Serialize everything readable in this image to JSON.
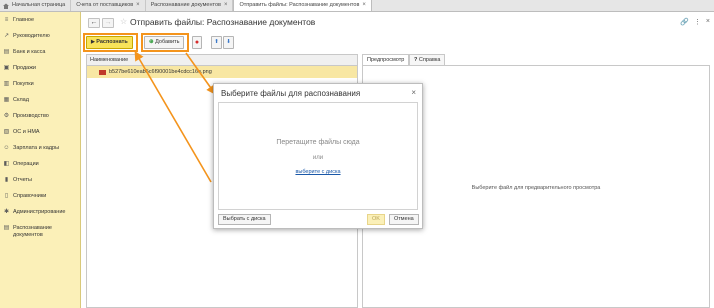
{
  "tabs": [
    {
      "label": "Начальная страница",
      "closable": false
    },
    {
      "label": "Счета от поставщиков",
      "closable": true
    },
    {
      "label": "Распознавание документов",
      "closable": true
    },
    {
      "label": "Отправить файлы: Распознавание документов",
      "closable": true
    }
  ],
  "sidebar": {
    "items": [
      {
        "label": "Главное",
        "icon": "menu-icon"
      },
      {
        "label": "Руководителю",
        "icon": "chart-icon"
      },
      {
        "label": "Банк и касса",
        "icon": "bank-icon"
      },
      {
        "label": "Продажи",
        "icon": "sales-icon"
      },
      {
        "label": "Покупки",
        "icon": "cart-icon"
      },
      {
        "label": "Склад",
        "icon": "warehouse-icon"
      },
      {
        "label": "Производство",
        "icon": "production-icon"
      },
      {
        "label": "ОС и НМА",
        "icon": "assets-icon"
      },
      {
        "label": "Зарплата и кадры",
        "icon": "people-icon"
      },
      {
        "label": "Операции",
        "icon": "operations-icon"
      },
      {
        "label": "Отчеты",
        "icon": "reports-icon"
      },
      {
        "label": "Справочники",
        "icon": "books-icon"
      },
      {
        "label": "Администрирование",
        "icon": "gear-icon"
      },
      {
        "label": "Распознавание документов",
        "icon": "scan-icon"
      }
    ]
  },
  "page": {
    "title": "Отправить файлы: Распознавание документов"
  },
  "toolbar": {
    "recognize": "Распознать",
    "add": "Добавить"
  },
  "table": {
    "header": "Наименование",
    "rows": [
      {
        "name": "b527be610eab5c6f90001be4cdcc16e.png"
      }
    ]
  },
  "right_tabs": {
    "preview": "Предпросмотр",
    "help_icon": "?",
    "help": "Справка"
  },
  "preview_text": "Выберите файл для предварительного просмотра",
  "modal": {
    "title": "Выберите файлы для распознавания",
    "drop_text": "Перетащите файлы сюда",
    "or": "или",
    "link": "выберите с диска",
    "choose_btn": "Выбрать с диска",
    "ok_btn": "OK",
    "cancel_btn": "Отмена"
  },
  "colors": {
    "sidebar_bg": "#fbf0b8",
    "highlight": "#f4941c",
    "primary_btn": "#f8e35a",
    "selected_row": "#f8e7a3"
  }
}
